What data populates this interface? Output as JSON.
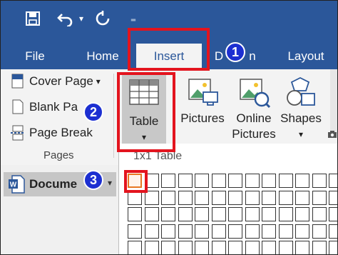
{
  "qat": {
    "save_icon": "save-icon",
    "undo_icon": "undo-icon",
    "undo_dropdown": "▾",
    "redo_icon": "redo-icon",
    "customize": "₌"
  },
  "tabs": [
    {
      "label": "File"
    },
    {
      "label": "Home"
    },
    {
      "label": "Insert"
    },
    {
      "label": "D"
    },
    {
      "label": "n"
    },
    {
      "label": "Layout"
    }
  ],
  "ribbon": {
    "pages": {
      "cover_page": "Cover Page",
      "cover_page_arrow": "▾",
      "blank_page": "Blank Pa",
      "page_break": "Page Break",
      "group_label": "Pages"
    },
    "table": {
      "label": "Table",
      "arrow": "▾"
    },
    "pictures": {
      "label": "Pictures"
    },
    "online_pictures": {
      "line1": "Online",
      "line2": "Pictures"
    },
    "shapes": {
      "label": "Shapes",
      "arrow": "▾"
    }
  },
  "table_menu": {
    "label": "1x1 Table",
    "rows": 5,
    "cols": 14,
    "selected": {
      "rows": 1,
      "cols": 1
    }
  },
  "nav": {
    "document": "Docume"
  },
  "annotations": {
    "step1": "1",
    "step2": "2",
    "step3": "3"
  },
  "colors": {
    "brand": "#2b579a",
    "annotation": "#e3141e",
    "badge": "#1c2fd1",
    "cell_highlight": "#e87722"
  }
}
